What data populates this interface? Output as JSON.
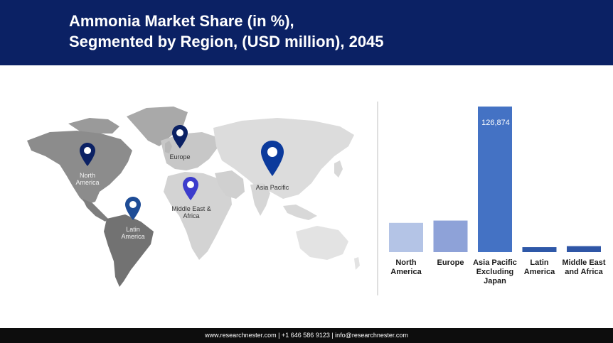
{
  "header": {
    "title_line1": "Ammonia Market Share (in %),",
    "title_line2": "Segmented by Region, (USD million), 2045"
  },
  "map": {
    "regions": [
      {
        "id": "north-america",
        "label_line1": "North",
        "label_line2": "America"
      },
      {
        "id": "europe",
        "label_line1": "Europe",
        "label_line2": ""
      },
      {
        "id": "asia-pacific",
        "label_line1": "Asia Pacific",
        "label_line2": ""
      },
      {
        "id": "middle-east-africa",
        "label_line1": "Middle East &",
        "label_line2": "Africa"
      },
      {
        "id": "latin-america",
        "label_line1": "Latin",
        "label_line2": "America"
      }
    ],
    "pin_colors": {
      "north-america": "#0b2164",
      "europe": "#0b2164",
      "asia-pacific": "#0b3a9c",
      "middle-east-africa": "#3c3ccc",
      "latin-america": "#1e4c96"
    },
    "icon": "map-pin-icon"
  },
  "chart_data": {
    "type": "bar",
    "title": "",
    "xlabel": "",
    "ylabel": "",
    "categories": [
      [
        "North",
        "America"
      ],
      [
        "Europe"
      ],
      [
        "Asia Pacific",
        "Excluding",
        "Japan"
      ],
      [
        "Latin",
        "America"
      ],
      [
        "Middle East",
        "and Africa"
      ]
    ],
    "values": [
      25500,
      27500,
      126874,
      4300,
      5200
    ],
    "colors": [
      "#b4c4e6",
      "#8ea2d8",
      "#4472c4",
      "#2e58a8",
      "#2f56a6"
    ],
    "data_labels": [
      "",
      "",
      "126,874",
      "",
      ""
    ],
    "ylim": [
      0,
      130000
    ],
    "grid": false,
    "legend": "none"
  },
  "footer": {
    "text": "www.researchnester.com | +1 646 586 9123 | info@researchnester.com"
  }
}
